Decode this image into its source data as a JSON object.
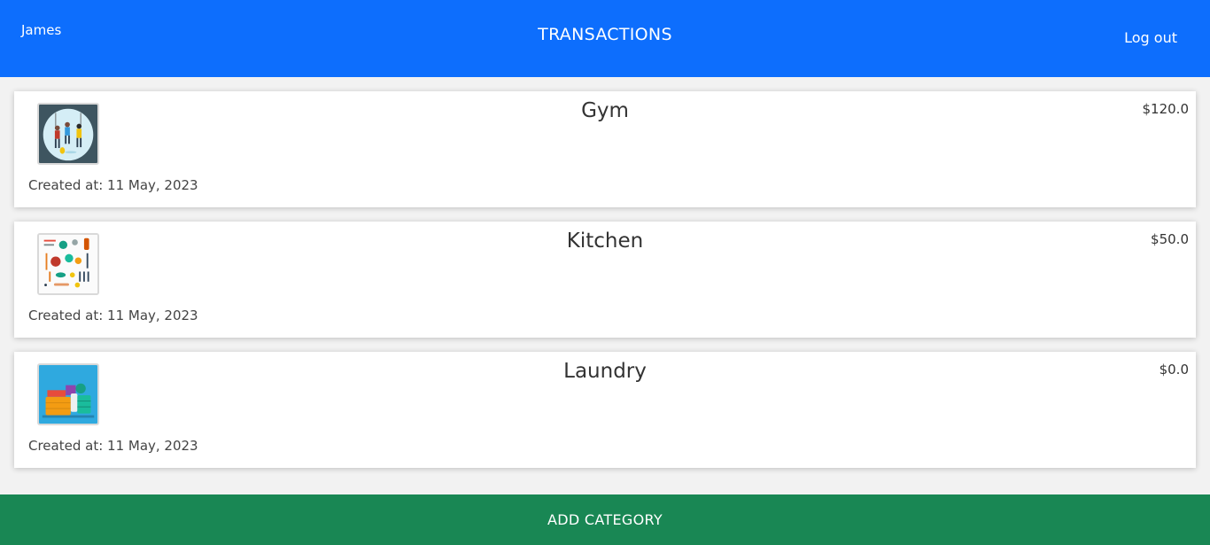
{
  "header": {
    "user": "James",
    "title": "TRANSACTIONS",
    "logout": "Log out"
  },
  "categories": [
    {
      "name": "Gym",
      "amount": "$120.0",
      "created": "Created at: 11 May, 2023",
      "icon": "gym-illustration-icon"
    },
    {
      "name": "Kitchen",
      "amount": "$50.0",
      "created": "Created at: 11 May, 2023",
      "icon": "kitchen-utensils-icon"
    },
    {
      "name": "Laundry",
      "amount": "$0.0",
      "created": "Created at: 11 May, 2023",
      "icon": "laundry-basket-icon"
    }
  ],
  "footer": {
    "add_label": "ADD CATEGORY"
  },
  "colors": {
    "header": "#0d6efd",
    "add_button": "#198754",
    "background": "#f2f2f2"
  }
}
